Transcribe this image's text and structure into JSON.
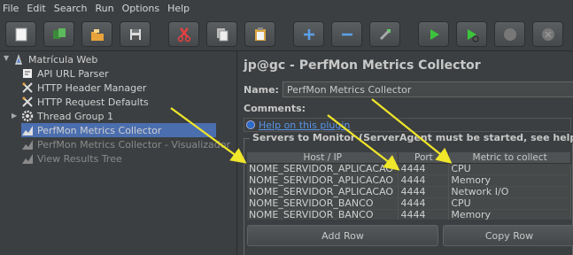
{
  "menu": [
    "File",
    "Edit",
    "Search",
    "Run",
    "Options",
    "Help"
  ],
  "toolbar": {
    "buttons": [
      "new-icon",
      "templates-icon",
      "open-icon",
      "save-icon",
      "cut-icon",
      "copy-icon",
      "paste-icon",
      "expand-icon",
      "collapse-icon",
      "toggle-icon",
      "start-icon",
      "start-no-pauses-icon",
      "stop-icon",
      "shutdown-icon"
    ]
  },
  "tree": {
    "items": [
      {
        "label": "Matrícula Web",
        "icon": "testplan-icon"
      },
      {
        "label": "API URL Parser",
        "icon": "preprocessor-icon"
      },
      {
        "label": "HTTP Header Manager",
        "icon": "config-icon"
      },
      {
        "label": "HTTP Request Defaults",
        "icon": "config-icon"
      },
      {
        "label": "Thread Group 1",
        "icon": "gear-icon"
      },
      {
        "label": "PerfMon Metrics Collector",
        "icon": "graph-icon"
      },
      {
        "label": "PerfMon Metrics Collector - Visualizador",
        "icon": "graph-icon"
      },
      {
        "label": "View Results Tree",
        "icon": "graph-icon"
      }
    ]
  },
  "panel": {
    "title": "jp@gc - PerfMon Metrics Collector",
    "name_label": "Name:",
    "name_value": "PerfMon Metrics Collector",
    "comments_label": "Comments:",
    "help_link": "Help on this plugin",
    "servers_legend": "Servers to Monitor (ServerAgent must be started, see help)",
    "table": {
      "headers": [
        "Host / IP",
        "Port",
        "Metric to collect"
      ],
      "rows": [
        [
          "NOME_SERVIDOR_APLICACAO",
          "4444",
          "CPU"
        ],
        [
          "NOME_SERVIDOR_APLICACAO",
          "4444",
          "Memory"
        ],
        [
          "NOME_SERVIDOR_APLICACAO",
          "4444",
          "Network I/O"
        ],
        [
          "NOME_SERVIDOR_BANCO",
          "4444",
          "CPU"
        ],
        [
          "NOME_SERVIDOR_BANCO",
          "4444",
          "Memory"
        ]
      ]
    },
    "add_row": "Add Row",
    "copy_row": "Copy Row"
  },
  "colors": {
    "background": "#3c3f41",
    "selection": "#4b6eaf",
    "arrow": "#f0e62a",
    "link": "#5794e8"
  }
}
